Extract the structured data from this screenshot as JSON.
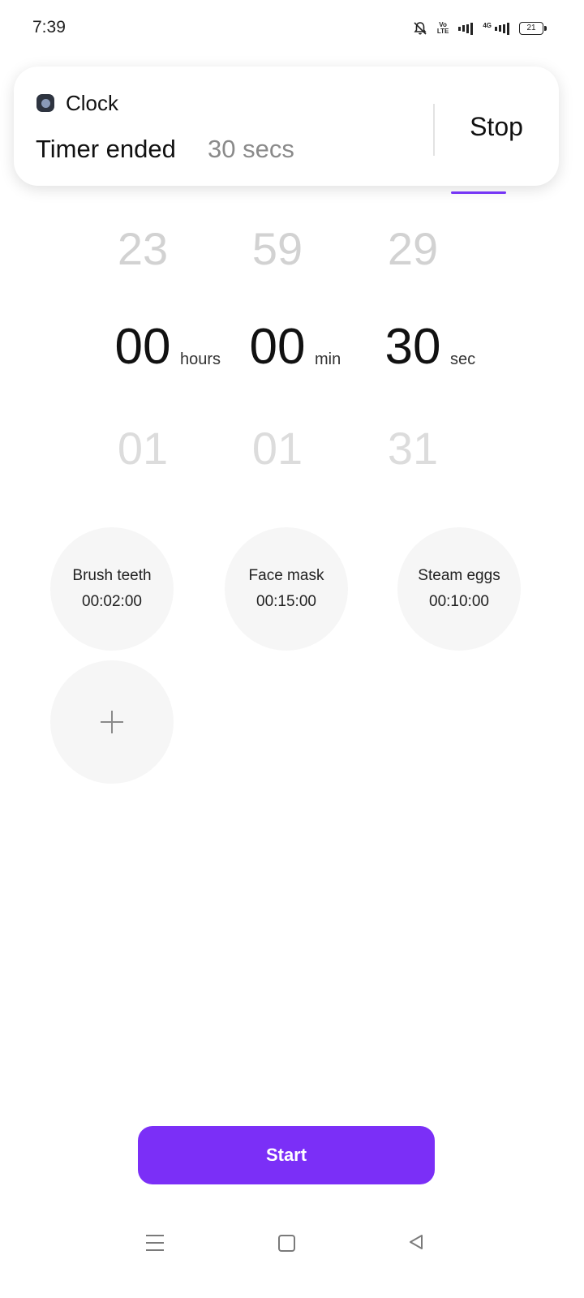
{
  "status_bar": {
    "time": "7:39",
    "volte_top": "Vo",
    "volte_bottom": "LTE",
    "network": "4G",
    "battery": "21"
  },
  "notification": {
    "app_name": "Clock",
    "title": "Timer ended",
    "duration": "30 secs",
    "action_label": "Stop"
  },
  "picker": {
    "hours": {
      "prev": "23",
      "current": "00",
      "next": "01",
      "unit": "hours"
    },
    "minutes": {
      "prev": "59",
      "current": "00",
      "next": "01",
      "unit": "min"
    },
    "seconds": {
      "prev": "29",
      "current": "30",
      "next": "31",
      "unit": "sec"
    }
  },
  "presets": [
    {
      "name": "Brush teeth",
      "time": "00:02:00"
    },
    {
      "name": "Face mask",
      "time": "00:15:00"
    },
    {
      "name": "Steam eggs",
      "time": "00:10:00"
    }
  ],
  "start_label": "Start",
  "colors": {
    "accent": "#7b2ff7",
    "tab_underline": "#7b39ff",
    "preset_bg": "#f6f6f6"
  },
  "icons": {
    "status": [
      "mute-bell-icon",
      "volte-icon",
      "signal-icon",
      "signal-4g-icon",
      "battery-icon"
    ],
    "nav": [
      "menu-icon",
      "home-icon",
      "back-icon"
    ],
    "add": "plus-icon"
  }
}
